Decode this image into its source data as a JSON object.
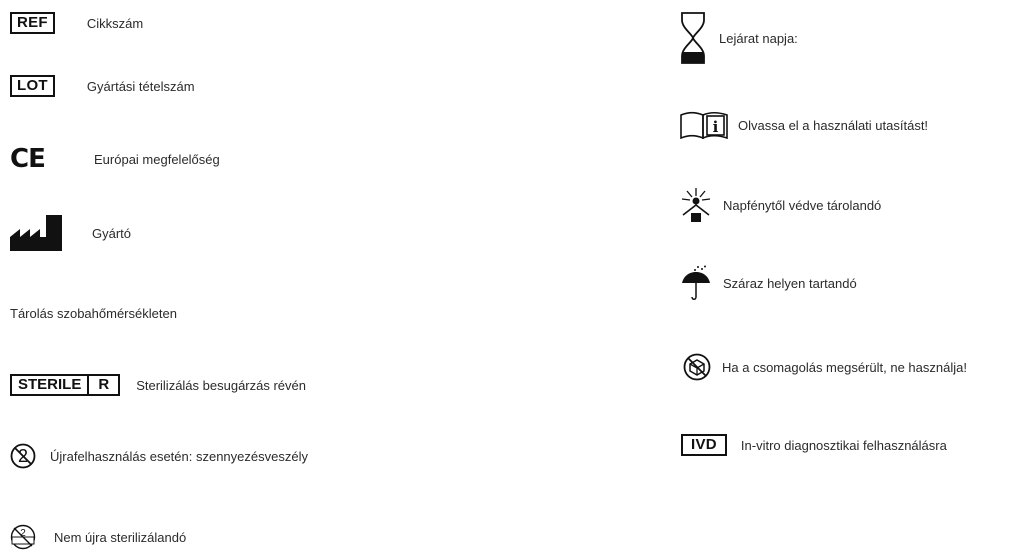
{
  "left": {
    "ref": {
      "symbol": "REF",
      "label": "Cikkszám"
    },
    "lot": {
      "symbol": "LOT",
      "label": "Gyártási tételszám"
    },
    "ce": {
      "symbol": "CE",
      "label": "Európai megfelelőség"
    },
    "manufacturer": {
      "icon": "factory-icon",
      "label": "Gyártó"
    },
    "storage_text": "Tárolás szobahőmérsékleten",
    "sterile": {
      "symbol_left": "STERILE",
      "symbol_right": "R",
      "label": "Sterilizálás besugárzás révén"
    },
    "no_reuse": {
      "icon": "do-not-reuse-icon",
      "label": "Újrafelhasználás esetén: szennyezésveszély"
    },
    "no_resterilize": {
      "icon": "do-not-resterilize-icon",
      "label": "Nem újra sterilizálandó"
    }
  },
  "right": {
    "expiry": {
      "icon": "hourglass-icon",
      "label": "Lejárat napja:"
    },
    "ifu": {
      "icon": "consult-instructions-icon",
      "label": "Olvassa el a használati utasítást!"
    },
    "sunlight": {
      "icon": "keep-away-from-sunlight-icon",
      "label": "Napfénytől védve tárolandó"
    },
    "dry": {
      "icon": "keep-dry-icon",
      "label": "Száraz helyen tartandó"
    },
    "damaged": {
      "icon": "do-not-use-if-damaged-icon",
      "label": "Ha a csomagolás megsérült, ne használja!"
    },
    "ivd": {
      "symbol": "IVD",
      "label": "In-vitro diagnosztikai felhasználásra"
    }
  }
}
